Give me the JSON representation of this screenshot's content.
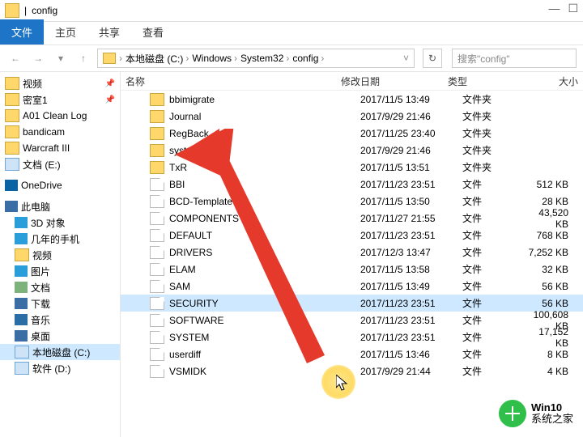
{
  "titlebar": {
    "title": "config",
    "sep": "|",
    "min": "—",
    "max": "☐"
  },
  "ribbon": {
    "file": "文件",
    "home": "主页",
    "share": "共享",
    "view": "查看"
  },
  "nav": {
    "back": "←",
    "fwd": "→",
    "up": "↑",
    "refresh": "↻",
    "crumbs": [
      "本地磁盘 (C:)",
      "Windows",
      "System32",
      "config"
    ],
    "search_placeholder": "搜索\"config\""
  },
  "tree": {
    "quick": [
      {
        "icon": "folder",
        "label": "视频",
        "pin": "📌"
      },
      {
        "icon": "folder",
        "label": "密室1",
        "pin": "📌"
      },
      {
        "icon": "folder",
        "label": "A01 Clean Log"
      },
      {
        "icon": "folder",
        "label": "bandicam"
      },
      {
        "icon": "folder",
        "label": "Warcraft III"
      },
      {
        "icon": "drive",
        "label": "文档 (E:)"
      }
    ],
    "onedrive": {
      "icon": "od",
      "label": "OneDrive"
    },
    "pc": {
      "icon": "pc",
      "label": "此电脑"
    },
    "pcitems": [
      {
        "icon": "img",
        "label": "3D 对象"
      },
      {
        "icon": "img",
        "label": "几年的手机"
      },
      {
        "icon": "folder",
        "label": "视频"
      },
      {
        "icon": "img",
        "label": "图片"
      },
      {
        "icon": "doc",
        "label": "文档"
      },
      {
        "icon": "dl",
        "label": "下载"
      },
      {
        "icon": "mus",
        "label": "音乐"
      },
      {
        "icon": "dsk",
        "label": "桌面"
      },
      {
        "icon": "drive",
        "label": "本地磁盘 (C:)",
        "sel": true
      },
      {
        "icon": "drive",
        "label": "软件 (D:)"
      }
    ]
  },
  "columns": {
    "name": "名称",
    "date": "修改日期",
    "type": "类型",
    "size": "大小"
  },
  "rows": [
    {
      "folder": true,
      "name": "bbimigrate",
      "date": "2017/11/5 13:49",
      "type": "文件夹",
      "size": ""
    },
    {
      "folder": true,
      "name": "Journal",
      "date": "2017/9/29 21:46",
      "type": "文件夹",
      "size": ""
    },
    {
      "folder": true,
      "name": "RegBack",
      "date": "2017/11/25 23:40",
      "type": "文件夹",
      "size": ""
    },
    {
      "folder": true,
      "name": "systemprofile",
      "date": "2017/9/29 21:46",
      "type": "文件夹",
      "size": ""
    },
    {
      "folder": true,
      "name": "TxR",
      "date": "2017/11/5 13:51",
      "type": "文件夹",
      "size": ""
    },
    {
      "folder": false,
      "name": "BBI",
      "date": "2017/11/23 23:51",
      "type": "文件",
      "size": "512 KB"
    },
    {
      "folder": false,
      "name": "BCD-Template",
      "date": "2017/11/5 13:50",
      "type": "文件",
      "size": "28 KB"
    },
    {
      "folder": false,
      "name": "COMPONENTS",
      "date": "2017/11/27 21:55",
      "type": "文件",
      "size": "43,520 KB"
    },
    {
      "folder": false,
      "name": "DEFAULT",
      "date": "2017/11/23 23:51",
      "type": "文件",
      "size": "768 KB"
    },
    {
      "folder": false,
      "name": "DRIVERS",
      "date": "2017/12/3 13:47",
      "type": "文件",
      "size": "7,252 KB"
    },
    {
      "folder": false,
      "name": "ELAM",
      "date": "2017/11/5 13:58",
      "type": "文件",
      "size": "32 KB"
    },
    {
      "folder": false,
      "name": "SAM",
      "date": "2017/11/5 13:49",
      "type": "文件",
      "size": "56 KB"
    },
    {
      "folder": false,
      "name": "SECURITY",
      "date": "2017/11/23 23:51",
      "type": "文件",
      "size": "56 KB",
      "sel": true
    },
    {
      "folder": false,
      "name": "SOFTWARE",
      "date": "2017/11/23 23:51",
      "type": "文件",
      "size": "100,608 KB"
    },
    {
      "folder": false,
      "name": "SYSTEM",
      "date": "2017/11/23 23:51",
      "type": "文件",
      "size": "17,152 KB"
    },
    {
      "folder": false,
      "name": "userdiff",
      "date": "2017/11/5 13:46",
      "type": "文件",
      "size": "8 KB"
    },
    {
      "folder": false,
      "name": "VSMIDK",
      "date": "2017/9/29 21:44",
      "type": "文件",
      "size": "4 KB"
    }
  ],
  "watermark": {
    "brand": "Win10",
    "sub": "系统之家"
  }
}
